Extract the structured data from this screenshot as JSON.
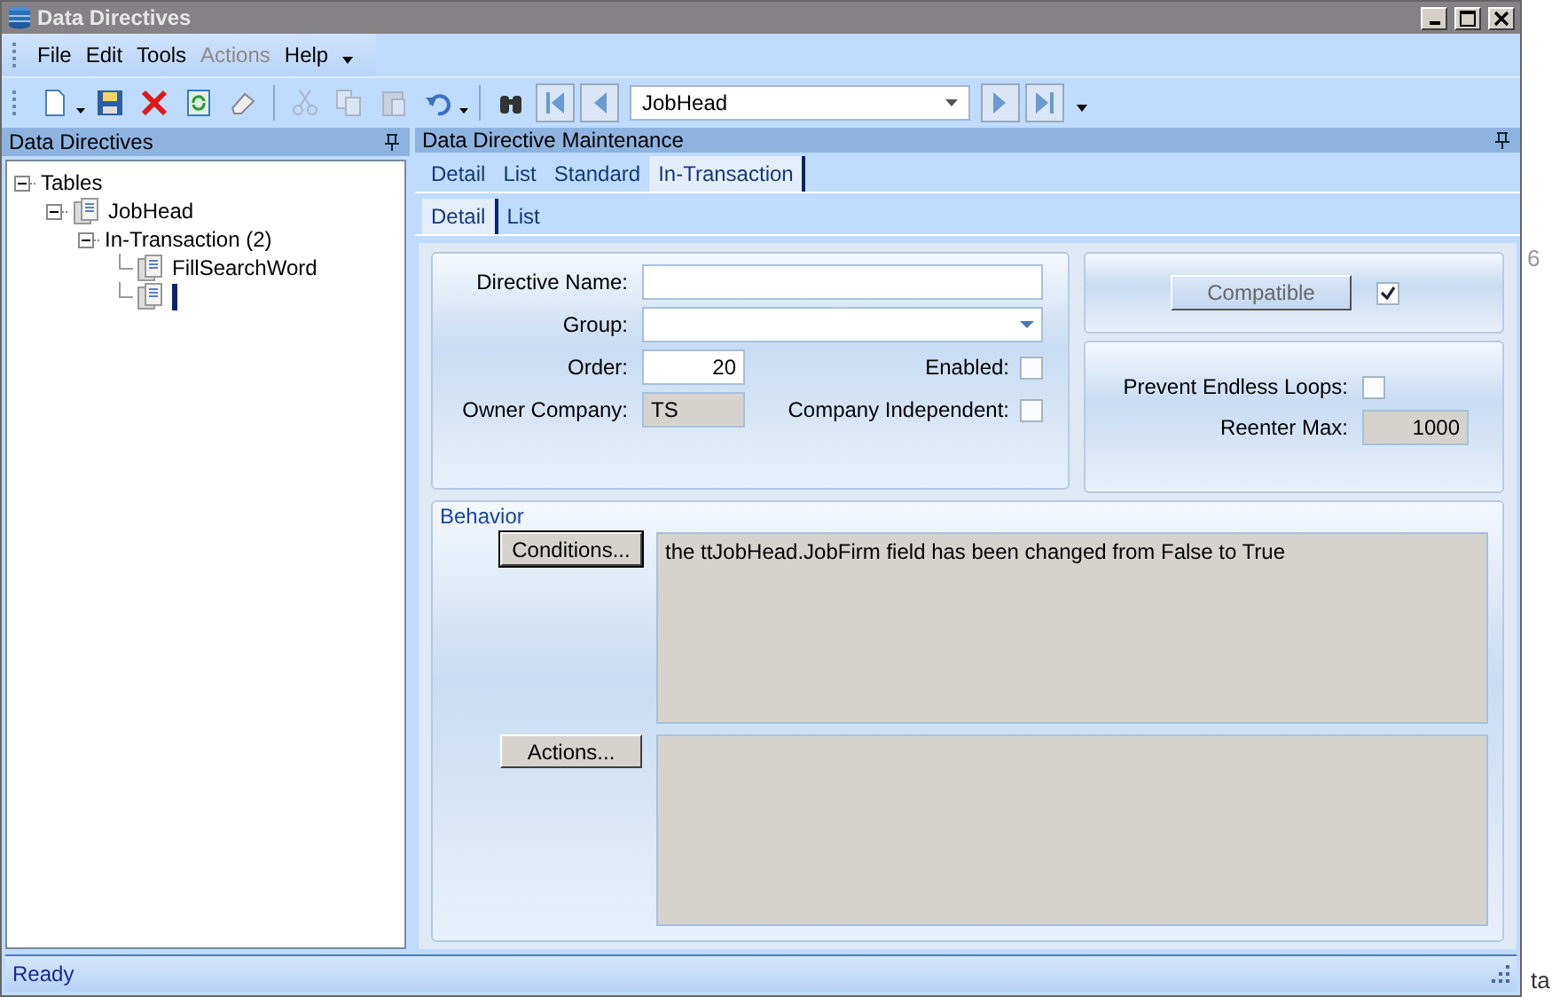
{
  "window": {
    "title": "Data Directives"
  },
  "menu": [
    {
      "label": "File",
      "disabled": false
    },
    {
      "label": "Edit",
      "disabled": false
    },
    {
      "label": "Tools",
      "disabled": false
    },
    {
      "label": "Actions",
      "disabled": true
    },
    {
      "label": "Help",
      "disabled": false
    }
  ],
  "toolbar": {
    "buttons": [
      {
        "kind": "new",
        "disabled": false
      },
      {
        "kind": "save",
        "disabled": false
      },
      {
        "kind": "delete",
        "disabled": false
      },
      {
        "kind": "refresh",
        "disabled": false
      },
      {
        "kind": "clear",
        "disabled": false
      },
      {
        "kind": "cut",
        "disabled": true
      },
      {
        "kind": "copy",
        "disabled": true
      },
      {
        "kind": "paste",
        "disabled": true
      },
      {
        "kind": "undo",
        "disabled": false
      },
      {
        "kind": "find",
        "disabled": false
      },
      {
        "kind": "first",
        "disabled": false
      },
      {
        "kind": "prev",
        "disabled": false
      }
    ],
    "record": "JobHead",
    "nav_buttons": [
      {
        "kind": "next",
        "disabled": false
      },
      {
        "kind": "last",
        "disabled": false
      }
    ]
  },
  "left_panel": {
    "title": "Data Directives",
    "tree": [
      {
        "label": "Tables",
        "expanded": true,
        "children": [
          {
            "label": "JobHead",
            "icon": true,
            "expanded": true,
            "children": [
              {
                "label": "In-Transaction (2)",
                "expanded": true,
                "children": [
                  {
                    "label": "FillSearchWord",
                    "icon": true
                  },
                  {
                    "icon": true,
                    "editing": true
                  }
                ]
              }
            ]
          }
        ]
      }
    ]
  },
  "right_panel": {
    "title": "Data Directive Maintenance",
    "tabs": [
      {
        "label": "Detail",
        "selected": false
      },
      {
        "label": "List",
        "selected": false
      },
      {
        "label": "Standard",
        "selected": false
      },
      {
        "label": "In-Transaction",
        "selected": true
      }
    ],
    "subtabs": [
      {
        "label": "Detail",
        "selected": true
      },
      {
        "label": "List",
        "selected": false
      }
    ],
    "form": {
      "directive_name": {
        "label": "Directive Name:"
      },
      "group": {
        "label": "Group:"
      },
      "order": {
        "label": "Order:",
        "value": "20"
      },
      "enabled": {
        "label": "Enabled:",
        "checked": false
      },
      "owner_company": {
        "label": "Owner Company:",
        "value": "TS"
      },
      "company_independent": {
        "label": "Company Independent:",
        "checked": false
      },
      "compatible": {
        "label": "Compatible",
        "checked": true
      },
      "prevent_endless_loops": {
        "label": "Prevent Endless Loops:",
        "checked": false
      },
      "reenter_max": {
        "label": "Reenter Max:",
        "value": "1000"
      }
    },
    "behavior": {
      "title": "Behavior",
      "conditions_button": "Conditions...",
      "conditions_text": "the ttJobHead.JobFirm field has been changed from False to True",
      "actions_button": "Actions..."
    }
  },
  "status_bar": {
    "text": "Ready"
  },
  "background_fragments": [
    "6",
    "ta"
  ]
}
